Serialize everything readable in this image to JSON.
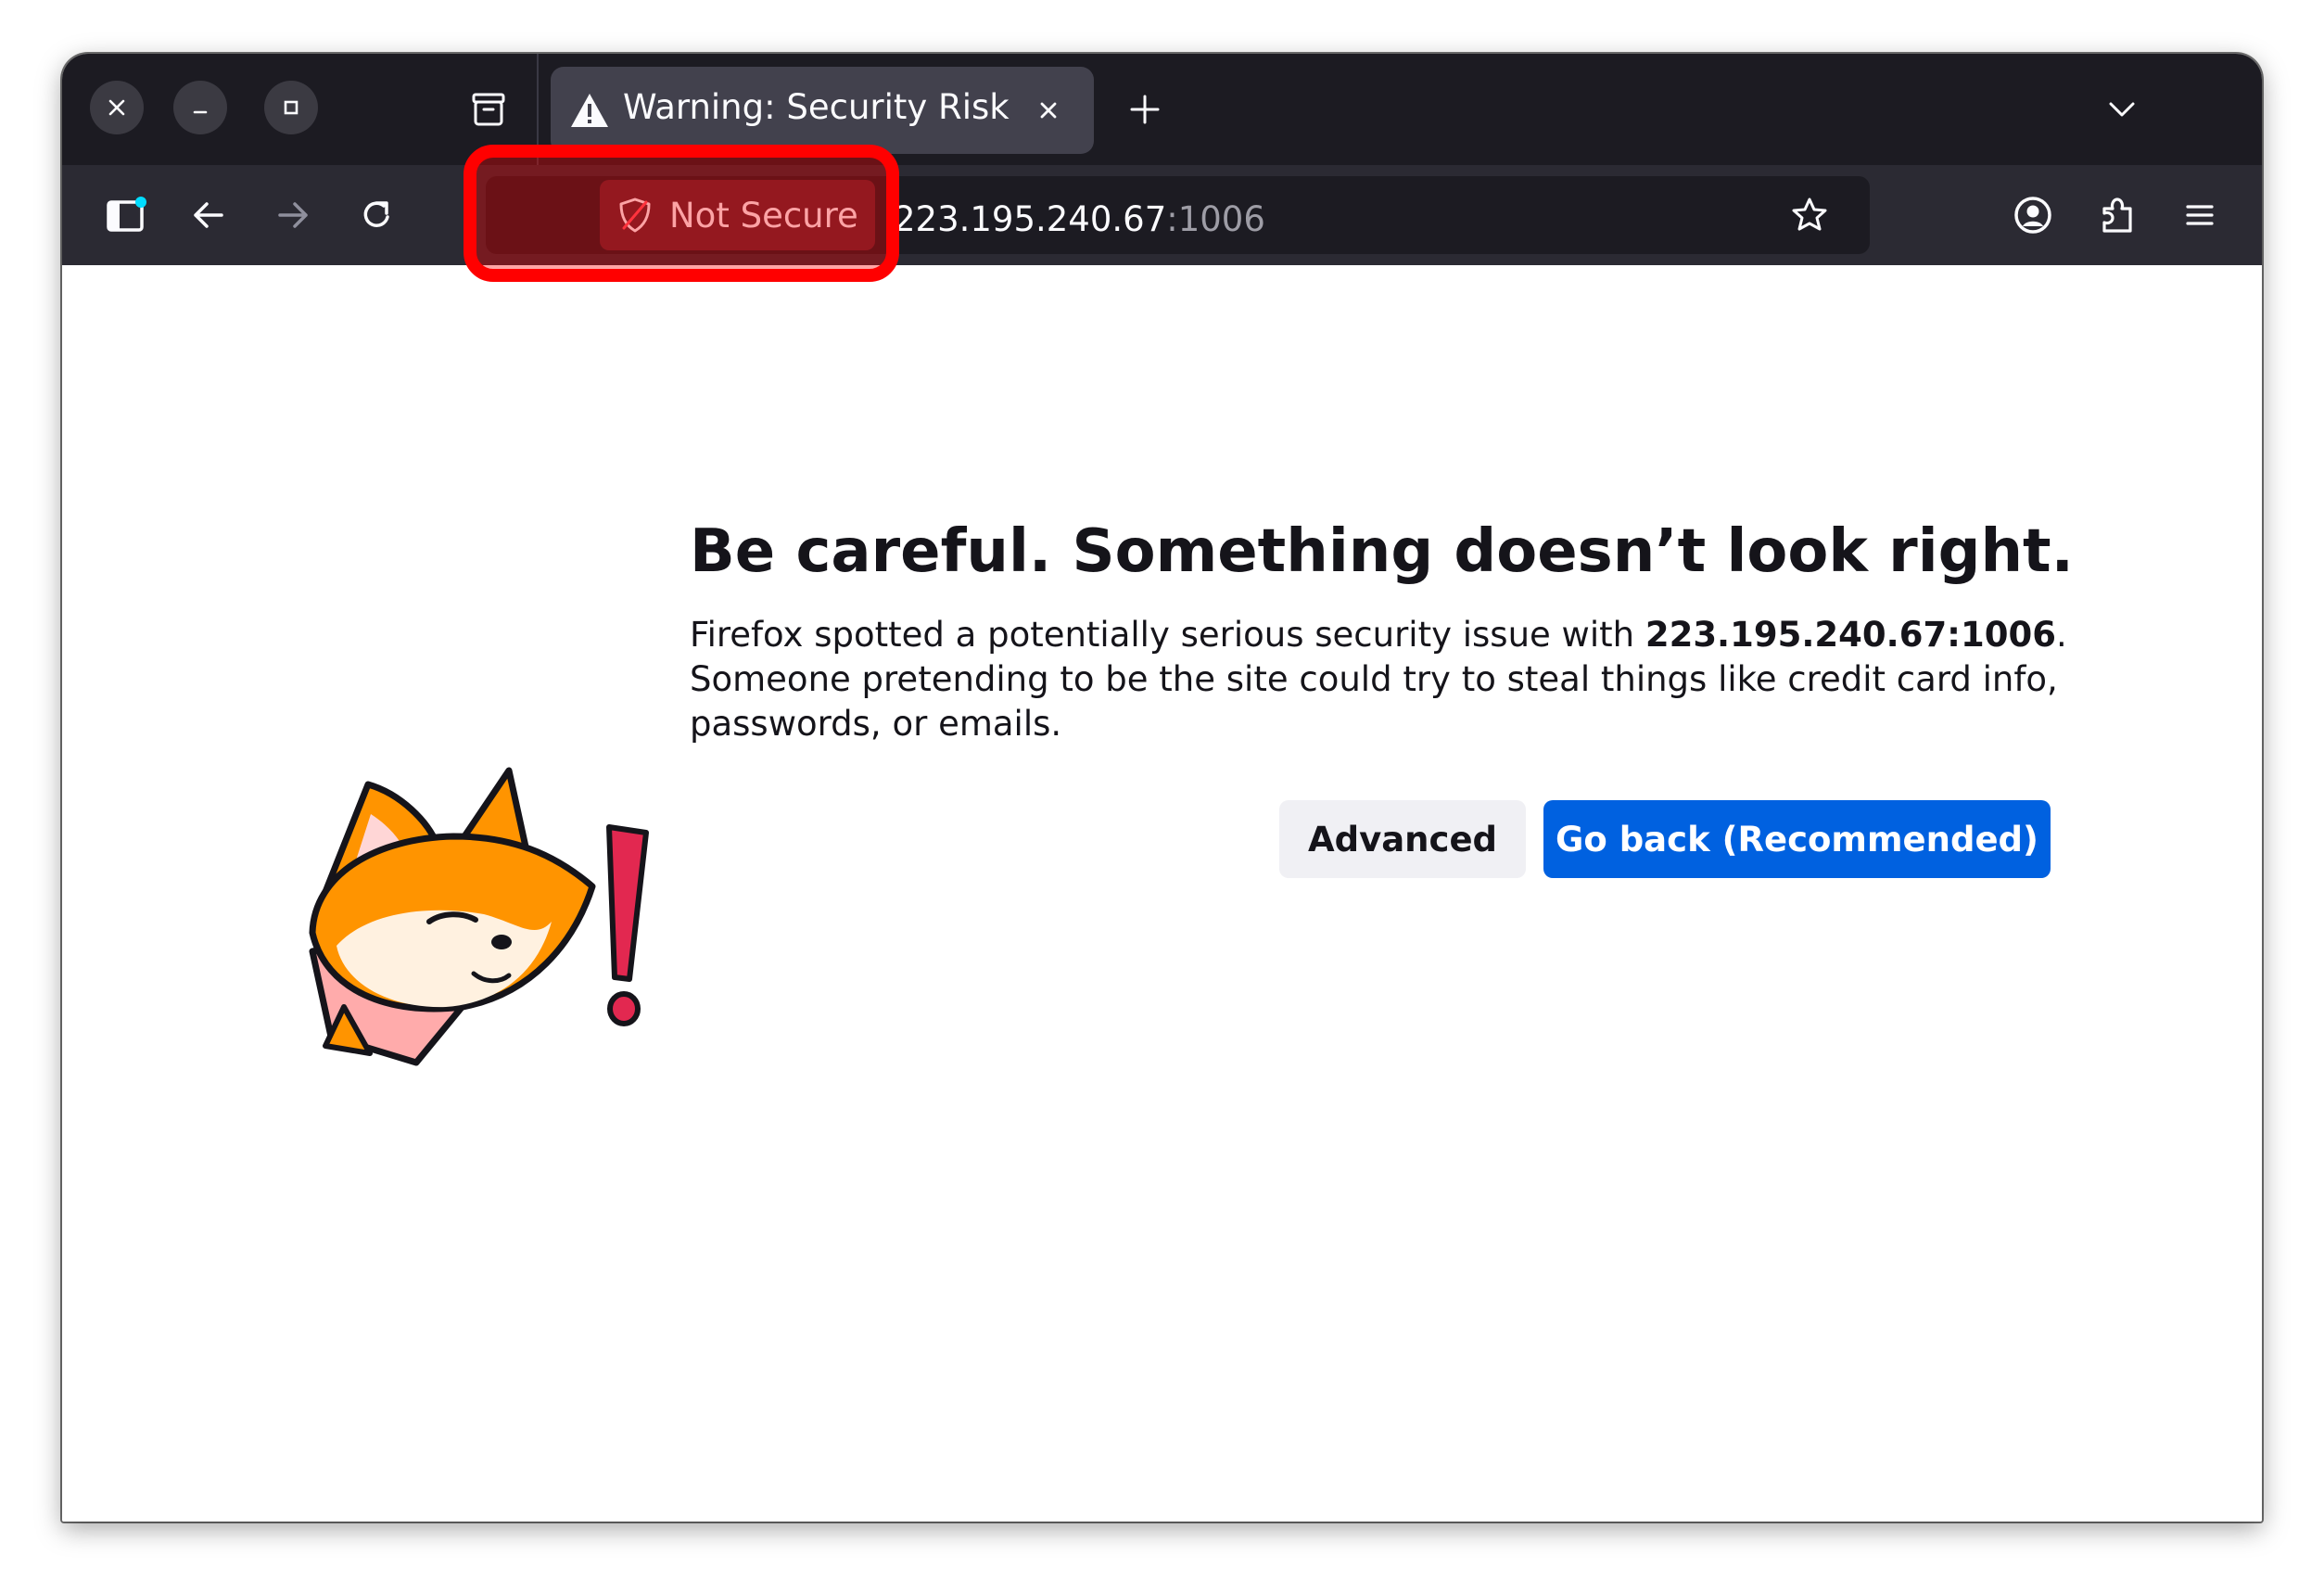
{
  "window": {
    "controls": [
      "close",
      "minimize",
      "maximize"
    ]
  },
  "tabs": [
    {
      "title": "Warning: Security Risk",
      "icon": "warning-triangle-icon",
      "active": true
    }
  ],
  "toolbar": {
    "security_label": "Not Secure",
    "url_host": "223.195.240.67",
    "url_port": ":1006"
  },
  "error_page": {
    "title": "Be careful. Something doesn’t look right.",
    "description_part1": "Firefox spotted a potentially serious security issue with ",
    "host": "223.195.240.67:1006",
    "description_part2": ". Someone pretending to be the site could try to steal things like credit card info, passwords, or emails.",
    "advanced_button": "Advanced",
    "go_back_button": "Go back (Recommended)"
  },
  "colors": {
    "tabbar_bg": "#1c1b22",
    "toolbar_bg": "#2b2a33",
    "urlbar_bg": "#1c1b22",
    "primary_button": "#0061e0",
    "secondary_button": "#f0f0f4",
    "highlight": "#ff0000"
  }
}
